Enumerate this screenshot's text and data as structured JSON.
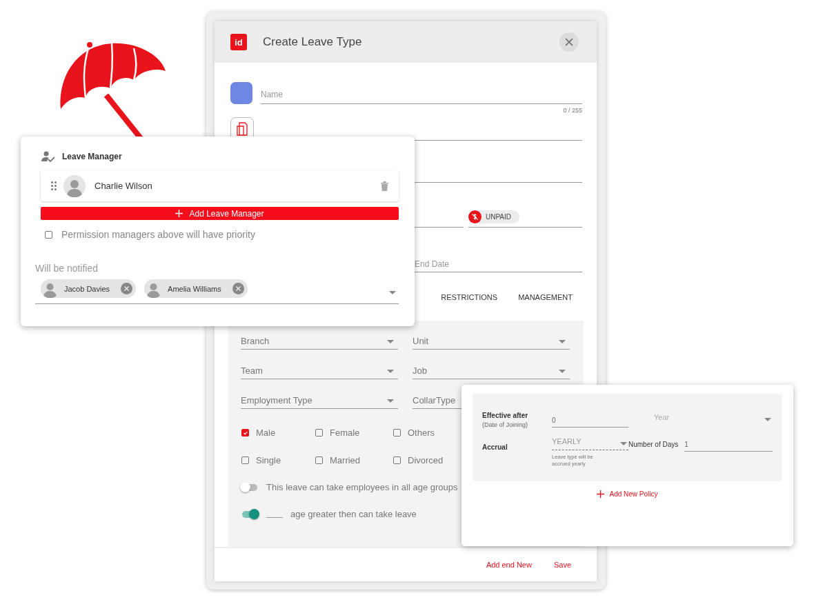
{
  "modal": {
    "logo": "id",
    "title": "Create Leave Type",
    "name_field": {
      "placeholder": "Name",
      "counter": "0 / 255"
    },
    "pay_chip": {
      "label": "UNPAID"
    },
    "end_date_field": {
      "placeholder": "End Date"
    },
    "tabs": [
      {
        "label": "RESTRICTIONS",
        "selected": false
      },
      {
        "label": "MANAGEMENT",
        "selected": false
      }
    ],
    "selects": [
      {
        "placeholder": "Branch"
      },
      {
        "placeholder": "Unit"
      },
      {
        "placeholder": "Team"
      },
      {
        "placeholder": "Job"
      },
      {
        "placeholder": "Employment Type"
      },
      {
        "placeholder": "CollarType"
      }
    ],
    "checkboxes": [
      {
        "label": "Male",
        "checked": true
      },
      {
        "label": "Female",
        "checked": false
      },
      {
        "label": "Others",
        "checked": false
      },
      {
        "label": "Single",
        "checked": false
      },
      {
        "label": "Married",
        "checked": false
      },
      {
        "label": "Divorced",
        "checked": false
      }
    ],
    "toggles": [
      {
        "kind": "text",
        "label": "This leave can take employees in all age groups",
        "on": false
      },
      {
        "kind": "blank",
        "label": "age greater then can take leave",
        "on": true
      }
    ],
    "actions": [
      "Add end New",
      "Save"
    ]
  },
  "manager_card": {
    "title": "Leave Manager",
    "managers": [
      {
        "name": "Charlie Wilson"
      }
    ],
    "add_button": "Add Leave Manager",
    "priority": {
      "label": "Permission managers above will have priority",
      "checked": false
    },
    "notified_label": "Will be notified",
    "notified": [
      {
        "name": "Jacob Davies"
      },
      {
        "name": "Amelia Williams"
      }
    ]
  },
  "policy_card": {
    "effective_label": "Effective after",
    "effective_sublabel": "(Date of Joining)",
    "effective_value": "0",
    "unit_placeholder": "Year",
    "accrual_label": "Accrual",
    "accrual_value": "YEARLY",
    "accrual_hint": "Leave type will be accrued yearly",
    "days_label": "Number of Days",
    "days_value": "1",
    "add_button": "Add New Policy"
  }
}
